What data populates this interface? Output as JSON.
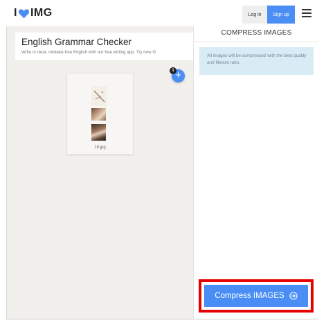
{
  "header": {
    "logo_left": "I",
    "logo_right": "IMG",
    "login_label": "Log in",
    "signup_label": "Sign up"
  },
  "ad": {
    "title": "English Grammar Checker",
    "subtitle": "Write in clear, mistake-free English with our free writing app. Try now G"
  },
  "file": {
    "name": "18.jpg"
  },
  "add_button": {
    "label": "+",
    "badge_count": "1"
  },
  "sidebar": {
    "title": "COMPRESS IMAGES",
    "info": "All images will be compressed with the best quality and filesize ratio.",
    "compress_label": "Compress IMAGES"
  },
  "colors": {
    "accent": "#4a8ef5",
    "heart": "#4a8ef5",
    "highlight": "#e60000",
    "info_bg": "#d9ecf6"
  },
  "icons": {
    "logo": "heart-icon",
    "menu": "hamburger-icon",
    "compress": "arrow-right-circle-icon"
  }
}
